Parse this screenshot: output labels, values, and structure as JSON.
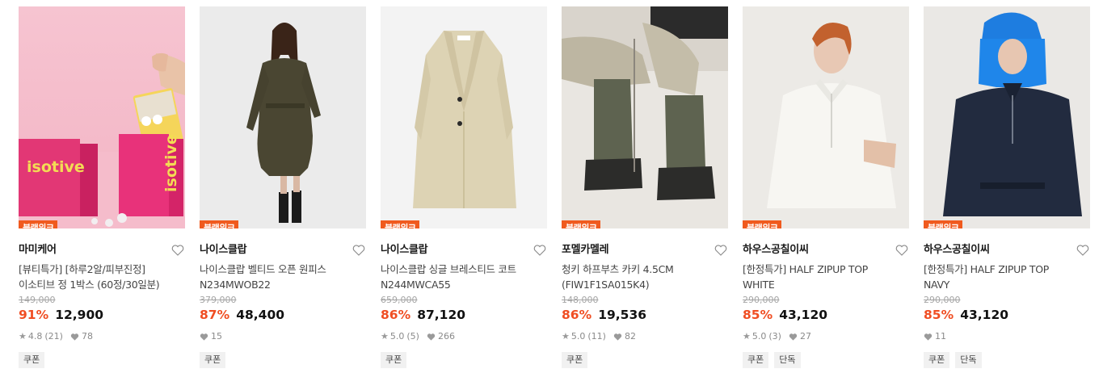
{
  "sale_tag": "블랙위크",
  "products": [
    {
      "brand": "마미케어",
      "name_line1": "[뷰티특가] [하루2알/피부진정]",
      "name_line2": "이소티브 정 1박스 (60정/30일분)",
      "original_price": "149,000",
      "discount": "91%",
      "price": "12,900",
      "rating": "4.8",
      "reviews": "(21)",
      "likes": "78",
      "badges": [
        "쿠폰"
      ],
      "product_text": "isotive"
    },
    {
      "brand": "나이스클랍",
      "name_line1": "나이스클랍 벨티드 오픈 원피스",
      "name_line2": "N234MWOB22",
      "original_price": "379,000",
      "discount": "87%",
      "price": "48,400",
      "rating": "",
      "reviews": "",
      "likes": "15",
      "badges": [
        "쿠폰"
      ]
    },
    {
      "brand": "나이스클랍",
      "name_line1": "나이스클랍 싱글 브레스티드 코트",
      "name_line2": "N244MWCA55",
      "original_price": "659,000",
      "discount": "86%",
      "price": "87,120",
      "rating": "5.0",
      "reviews": "(5)",
      "likes": "266",
      "badges": [
        "쿠폰"
      ]
    },
    {
      "brand": "포멜카멜레",
      "name_line1": "청키 하프부츠 카키 4.5CM",
      "name_line2": "(FIW1F1SA015K4)",
      "original_price": "148,000",
      "discount": "86%",
      "price": "19,536",
      "rating": "5.0",
      "reviews": "(11)",
      "likes": "82",
      "badges": [
        "쿠폰"
      ]
    },
    {
      "brand": "하우스공칠이씨",
      "name_line1": "[한정특가] HALF ZIPUP TOP",
      "name_line2": "WHITE",
      "original_price": "290,000",
      "discount": "85%",
      "price": "43,120",
      "rating": "5.0",
      "reviews": "(3)",
      "likes": "27",
      "badges": [
        "쿠폰",
        "단독"
      ]
    },
    {
      "brand": "하우스공칠이씨",
      "name_line1": "[한정특가] HALF ZIPUP TOP",
      "name_line2": "NAVY",
      "original_price": "290,000",
      "discount": "85%",
      "price": "43,120",
      "rating": "",
      "reviews": "",
      "likes": "11",
      "badges": [
        "쿠폰",
        "단독"
      ]
    }
  ]
}
